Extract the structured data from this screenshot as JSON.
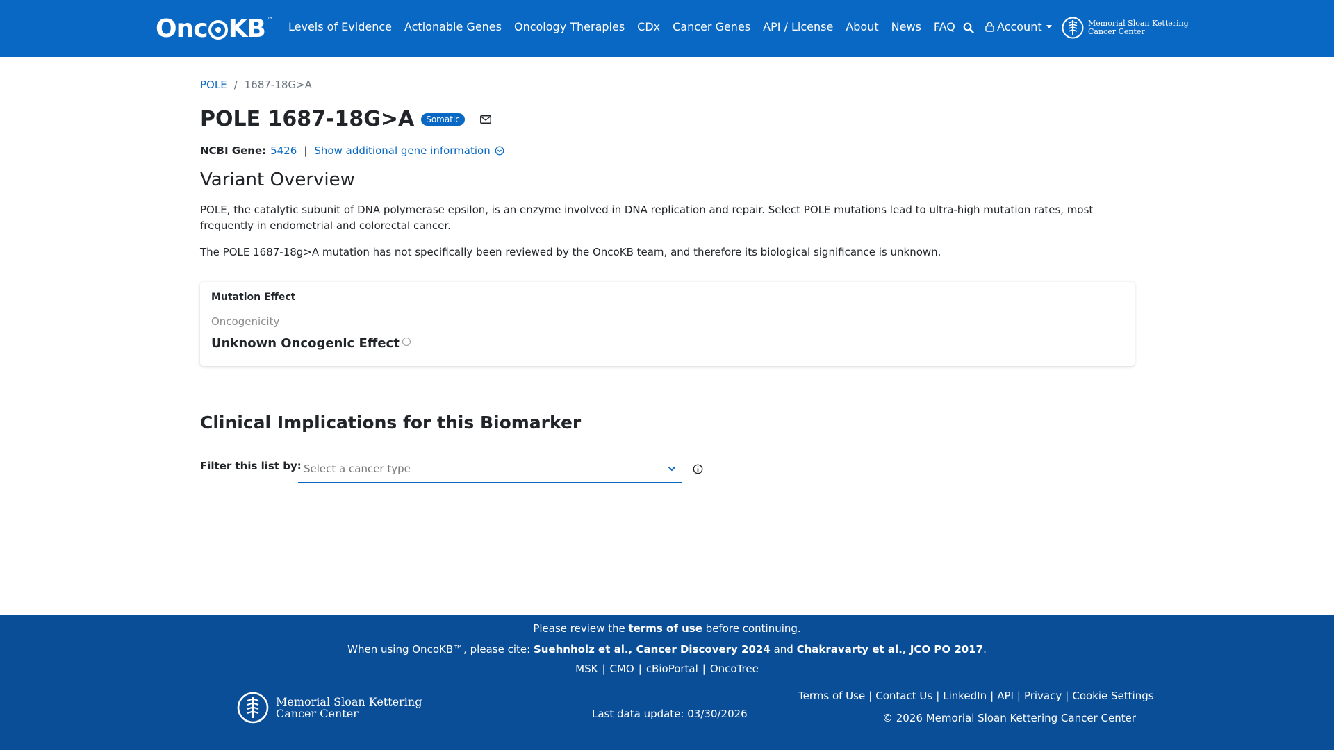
{
  "header": {
    "logo_text": "OncoKB",
    "logo_tm": "™",
    "nav": [
      "Levels of Evidence",
      "Actionable Genes",
      "Oncology Therapies",
      "CDx",
      "Cancer Genes",
      "API / License",
      "About",
      "News",
      "FAQ"
    ],
    "account_label": "Account",
    "msk_logo_lines": [
      "Memorial Sloan Kettering",
      "Cancer Center"
    ]
  },
  "breadcrumb": {
    "gene": "POLE",
    "sep": "/",
    "variant": "1687-18G>A"
  },
  "title": {
    "text": "POLE 1687-18G>A",
    "badge": "Somatic"
  },
  "gene_info": {
    "label": "NCBI Gene:",
    "gene_id": "5426",
    "sep": "|",
    "more_link": "Show additional gene information"
  },
  "overview": {
    "heading": "Variant Overview",
    "paragraph1": "POLE, the catalytic subunit of DNA polymerase epsilon, is an enzyme involved in DNA replication and repair. Select POLE mutations lead to ultra-high mutation rates, most frequently in endometrial and colorectal cancer.",
    "paragraph2": "The POLE 1687-18g>A mutation has not specifically been reviewed by the OncoKB team, and therefore its biological significance is unknown."
  },
  "mutation_card": {
    "title": "Mutation Effect",
    "subtitle": "Oncogenicity",
    "value": "Unknown Oncogenic Effect"
  },
  "clinical": {
    "heading": "Clinical Implications for this Biomarker",
    "filter_label": "Filter this list by:",
    "filter_placeholder": "Select a cancer type"
  },
  "footer": {
    "review_pre": "Please review the",
    "review_link": "terms of use",
    "review_post": "before continuing.",
    "cite_pre": "When using OncoKB™, please cite:",
    "cite_1": "Suehnholz et al., Cancer Discovery 2024",
    "cite_and": "and",
    "cite_2": "Chakravarty et al., JCO PO 2017",
    "cite_end": ".",
    "partner_links": [
      "MSK",
      "CMO",
      "cBioPortal",
      "OncoTree"
    ],
    "msk_logo_lines": [
      "Memorial Sloan Kettering",
      "Cancer Center"
    ],
    "last_update": "Last data update: 03/30/2026",
    "links": [
      "Terms of Use",
      "Contact Us",
      "LinkedIn",
      "API",
      "Privacy",
      "Cookie Settings"
    ],
    "copyright": "© 2026 Memorial Sloan Kettering Cancer Center"
  },
  "colors": {
    "primary": "#0968c3",
    "footer_bg": "#0a4e98"
  }
}
